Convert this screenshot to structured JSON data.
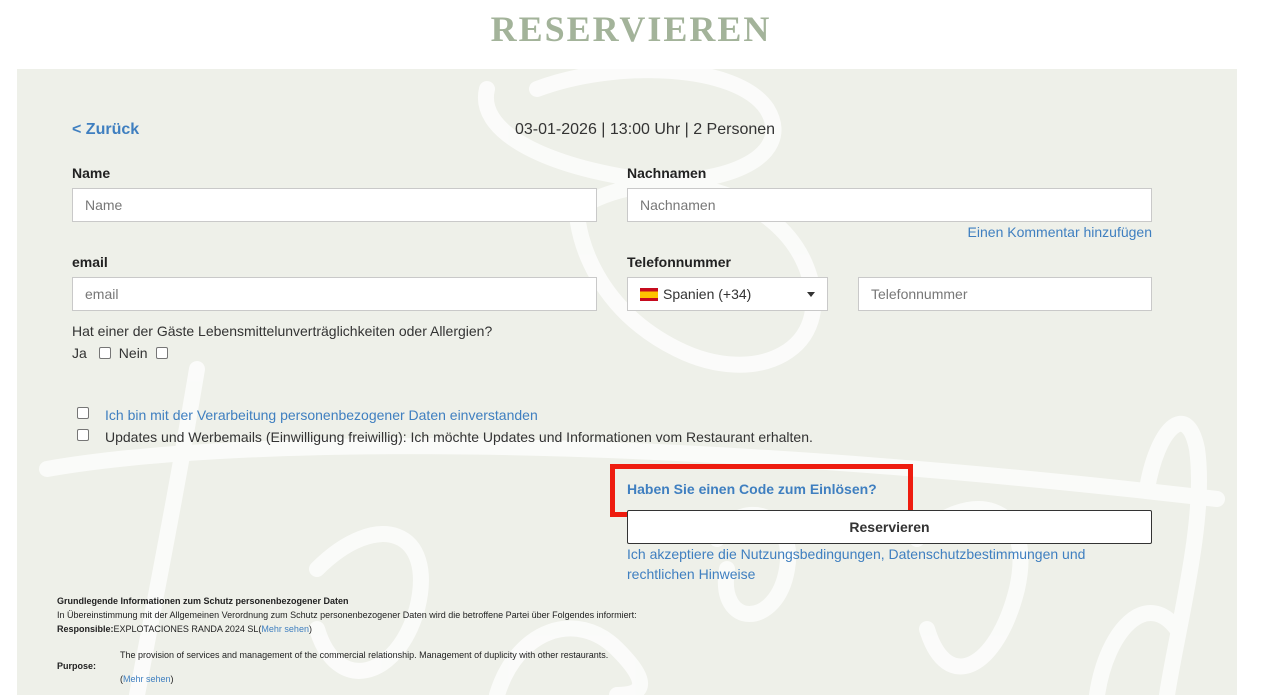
{
  "title": "RESERVIEREN",
  "back_link": "< Zurück",
  "booking_summary": "03-01-2026 | 13:00 Uhr | 2 Personen",
  "fields": {
    "name": {
      "label": "Name",
      "placeholder": "Name"
    },
    "surname": {
      "label": "Nachnamen",
      "placeholder": "Nachnamen"
    },
    "email": {
      "label": "email",
      "placeholder": "email"
    },
    "phone": {
      "label": "Telefonnummer",
      "placeholder": "Telefonnummer"
    }
  },
  "add_comment_link": "Einen Kommentar hinzufügen",
  "country_select": {
    "value": "Spanien (+34)",
    "flag_icon": "spain-flag-icon"
  },
  "allergy": {
    "question": "Hat einer der Gäste Lebensmittelunverträglichkeiten oder Allergien?",
    "yes": "Ja",
    "no": "Nein"
  },
  "consents": {
    "data_processing": "Ich bin mit der Verarbeitung personenbezogener Daten einverstanden",
    "marketing": "Updates und Werbemails (Einwilligung freiwillig): Ich möchte Updates und Informationen vom Restaurant erhalten."
  },
  "code_link": "Haben Sie einen Code zum Einlösen?",
  "reserve_button": "Reservieren",
  "terms": "Ich akzeptiere die Nutzungsbedingungen, Datenschutzbestimmungen und rechtlichen Hinweise",
  "legal": {
    "heading": "Grundlegende Informationen zum Schutz personenbezogener Daten",
    "intro": "In Übereinstimmung mit der Allgemeinen Verordnung zum Schutz personenbezogener Daten wird die betroffene Partei über Folgendes informiert:",
    "responsible_label": "Responsible:",
    "responsible_value": "EXPLOTACIONES RANDA 2024 SL",
    "more_link": "Mehr sehen",
    "purpose_label": "Purpose:",
    "purpose_value": "The provision of services and management of the commercial relationship. Management of duplicity with other restaurants."
  },
  "colors": {
    "accent": "#3f7fc0",
    "title": "#a3b39a",
    "panel": "#eef0e9",
    "highlight": "#ee1c0f"
  }
}
